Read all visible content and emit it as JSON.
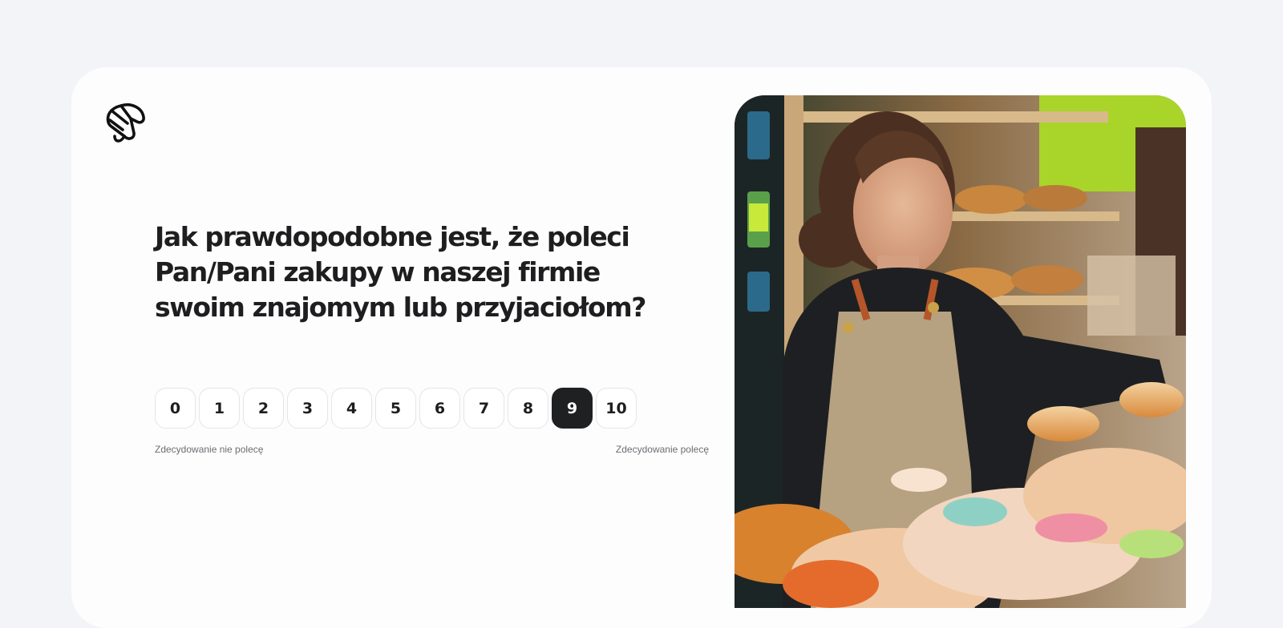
{
  "survey": {
    "logo_icon": "croissant-icon",
    "question": "Jak prawdopodobne jest, że poleci Pan/Pani zakupy w naszej firmie swoim znajomym lub przyjaciołom?",
    "scale": [
      "0",
      "1",
      "2",
      "3",
      "4",
      "5",
      "6",
      "7",
      "8",
      "9",
      "10"
    ],
    "selected_score": "9",
    "label_low": "Zdecydowanie nie polecę",
    "label_high": "Zdecydowanie polecę"
  },
  "colors": {
    "background": "#f3f4f8",
    "card": "#fdfdfd",
    "selected": "#1f2022",
    "text": "#1e1e20"
  }
}
